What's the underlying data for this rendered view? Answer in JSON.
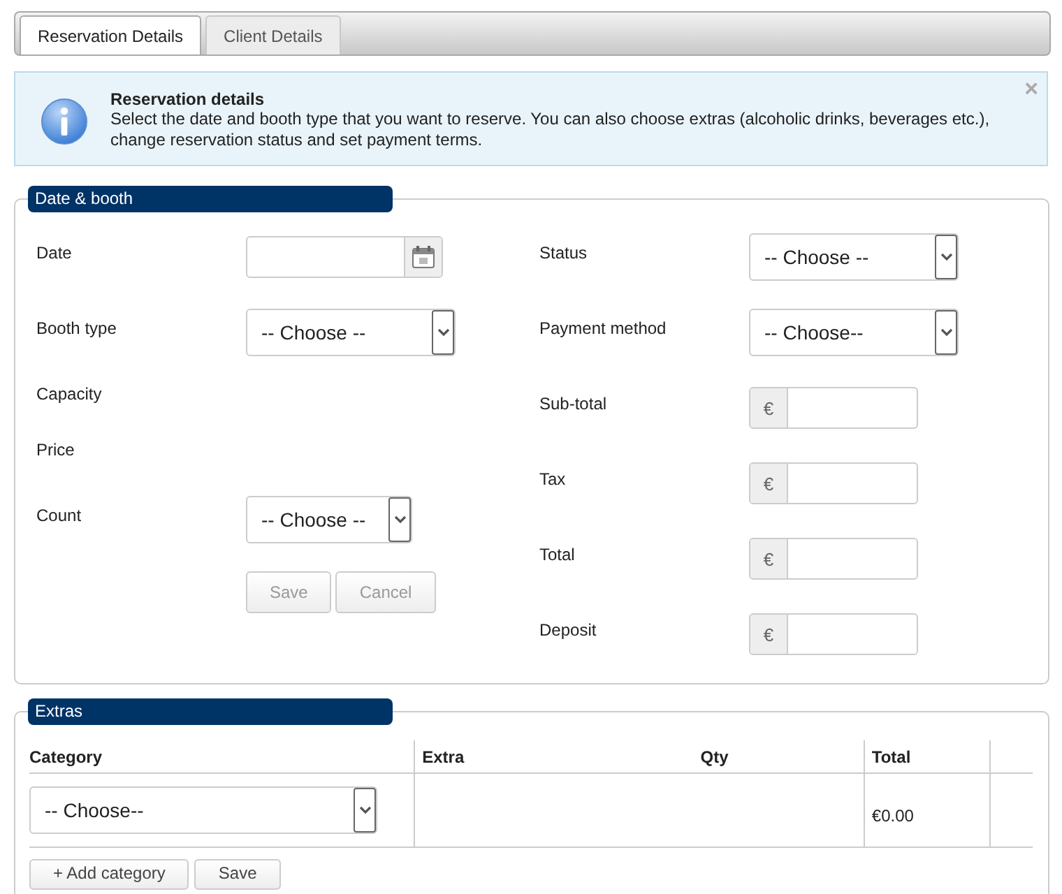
{
  "tabs": [
    {
      "label": "Reservation Details",
      "selected": true
    },
    {
      "label": "Client Details",
      "selected": false
    }
  ],
  "alert": {
    "title": "Reservation details",
    "text": "Select the date and booth type that you want to reserve. You can also choose extras (alcoholic drinks, beverages etc.), change reservation status and set payment terms.",
    "close": "×"
  },
  "date_booth": {
    "legend": "Date & booth",
    "left_fields": [
      {
        "kind": "date",
        "label": "Date"
      },
      {
        "kind": "select",
        "label": "Booth type",
        "value": "-- Choose --"
      },
      {
        "kind": "plain",
        "label": "Capacity"
      },
      {
        "kind": "plain",
        "label": "Price"
      },
      {
        "kind": "select",
        "label": "Count",
        "value": "-- Choose --"
      }
    ],
    "buttons": [
      {
        "label": "Save",
        "disabled": true
      },
      {
        "label": "Cancel",
        "disabled": true
      }
    ],
    "right_fields": [
      {
        "kind": "select",
        "label": "Status",
        "value": "-- Choose --"
      },
      {
        "kind": "select",
        "label": "Payment method",
        "value": "-- Choose--"
      },
      {
        "kind": "currency",
        "label": "Sub-total",
        "symbol": "€"
      },
      {
        "kind": "currency",
        "label": "Tax",
        "symbol": "€"
      },
      {
        "kind": "currency",
        "label": "Total",
        "symbol": "€"
      },
      {
        "kind": "currency",
        "label": "Deposit",
        "symbol": "€"
      }
    ]
  },
  "extras": {
    "legend": "Extras",
    "columns": [
      "Category",
      "Extra",
      "Qty",
      "Total"
    ],
    "rows": [
      {
        "category": "-- Choose--",
        "total": "€0.00"
      }
    ],
    "buttons": [
      {
        "label": "+ Add category"
      },
      {
        "label": "Save"
      }
    ]
  }
}
